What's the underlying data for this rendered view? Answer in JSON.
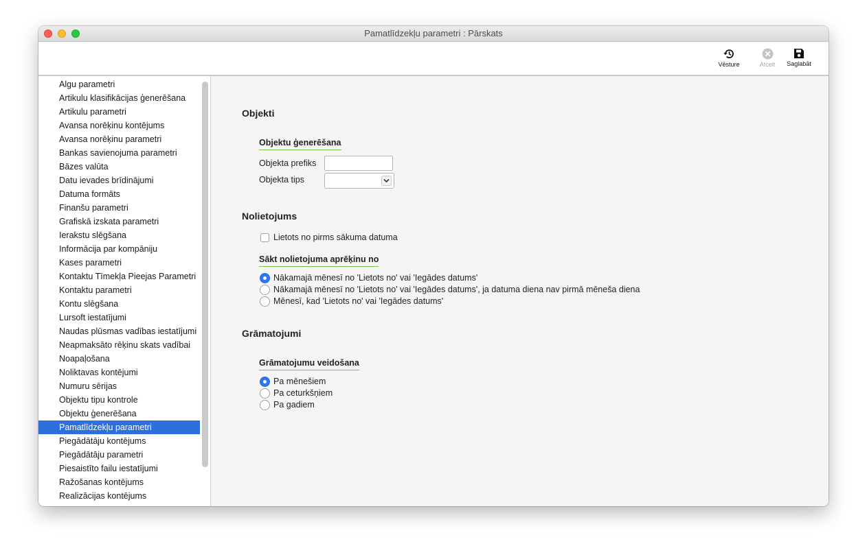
{
  "window": {
    "title": "Pamatlīdzekļu parametri : Pārskats"
  },
  "toolbar": {
    "history_label": "Vēsture",
    "cancel_label": "Atcelt",
    "save_label": "Saglabāt"
  },
  "sidebar": {
    "items": [
      "Algu parametri",
      "Artikulu klasifikācijas ģenerēšana",
      "Artikulu parametri",
      "Avansa norēķinu kontējums",
      "Avansa norēķinu parametri",
      "Bankas savienojuma parametri",
      "Bāzes valūta",
      "Datu ievades brīdinājumi",
      "Datuma formāts",
      "Finanšu parametri",
      "Grafiskā izskata parametri",
      "Ierakstu slēgšana",
      "Informācija par kompāniju",
      "Kases parametri",
      "Kontaktu Tīmekļa Pieejas Parametri",
      "Kontaktu parametri",
      "Kontu slēgšana",
      "Lursoft iestatījumi",
      "Naudas plūsmas vadības iestatījumi",
      "Neapmaksāto rēķinu skats vadībai",
      "Noapaļošana",
      "Noliktavas kontējumi",
      "Numuru sērijas",
      "Objektu tipu kontrole",
      "Objektu ģenerēšana",
      "Pamatlīdzekļu parametri",
      "Piegādātāju kontējums",
      "Piegādātāju parametri",
      "Piesaistīto failu iestatījumi",
      "Ražošanas kontējums",
      "Realizācijas kontējums"
    ],
    "selected_index": 25
  },
  "objekti": {
    "title": "Objekti",
    "group_title": "Objektu ģenerēšana",
    "prefix_label": "Objekta prefiks",
    "prefix_value": "",
    "type_label": "Objekta tips",
    "type_value": ""
  },
  "nolietojums": {
    "title": "Nolietojums",
    "checkbox_label": "Lietots no pirms sākuma datuma",
    "checkbox_checked": false,
    "group_title": "Sākt nolietojuma aprēķinu no",
    "options": [
      "Nākamajā mēnesī no 'Lietots no' vai 'Iegādes datums'",
      "Nākamajā mēnesī no 'Lietots no' vai 'Iegādes datums', ja datuma diena nav pirmā mēneša diena",
      "Mēnesī, kad 'Lietots no' vai 'Iegādes datums'"
    ],
    "selected_option": 0
  },
  "gramatojumi": {
    "title": "Grāmatojumi",
    "group_title": "Grāmatojumu veidošana",
    "options": [
      "Pa mēnešiem",
      "Pa ceturkšņiem",
      "Pa gadiem"
    ],
    "selected_option": 0
  },
  "colors": {
    "selection": "#2f6fdb",
    "radio_checked": "#2f76f3",
    "group_underline": "#7cc242"
  }
}
